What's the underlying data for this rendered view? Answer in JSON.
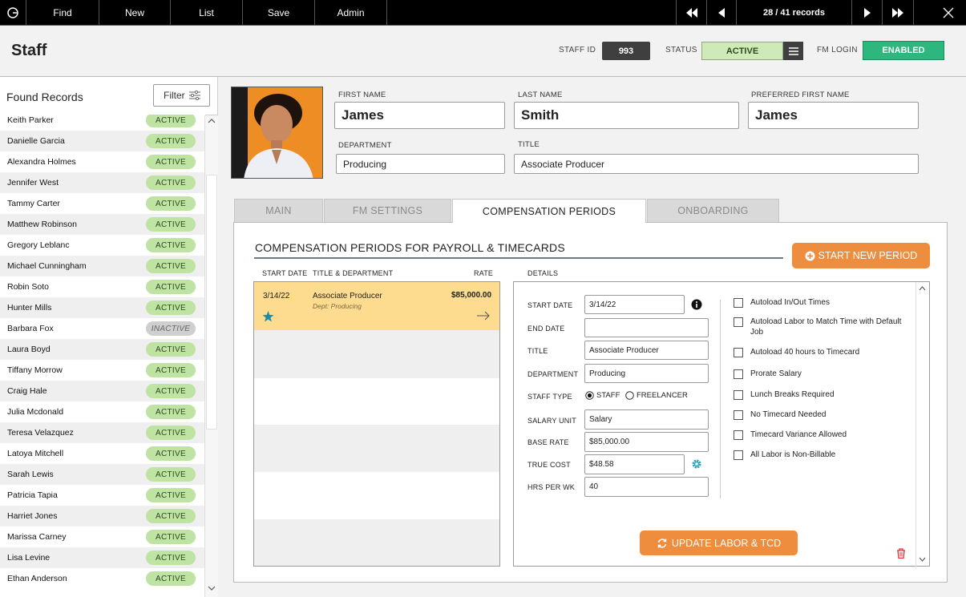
{
  "topbar": {
    "find": "Find",
    "new": "New",
    "list": "List",
    "save": "Save",
    "admin": "Admin",
    "record_counter": "28 / 41 records"
  },
  "header": {
    "title": "Staff",
    "staff_id_label": "STAFF ID",
    "staff_id": "993",
    "status_label": "STATUS",
    "status": "ACTIVE",
    "fm_login_label": "FM LOGIN",
    "fm_login": "ENABLED"
  },
  "sidebar": {
    "title": "Found Records",
    "filter_label": "Filter",
    "records": [
      {
        "name": "Keith Parker",
        "status": "ACTIVE"
      },
      {
        "name": "Danielle Garcia",
        "status": "ACTIVE"
      },
      {
        "name": "Alexandra Holmes",
        "status": "ACTIVE"
      },
      {
        "name": "Jennifer West",
        "status": "ACTIVE"
      },
      {
        "name": "Tammy Carter",
        "status": "ACTIVE"
      },
      {
        "name": "Matthew Robinson",
        "status": "ACTIVE"
      },
      {
        "name": "Gregory Leblanc",
        "status": "ACTIVE"
      },
      {
        "name": "Michael Cunningham",
        "status": "ACTIVE"
      },
      {
        "name": "Robin Soto",
        "status": "ACTIVE"
      },
      {
        "name": "Hunter Mills",
        "status": "ACTIVE"
      },
      {
        "name": "Barbara Fox",
        "status": "INACTIVE"
      },
      {
        "name": "Laura Boyd",
        "status": "ACTIVE"
      },
      {
        "name": "Tiffany Morrow",
        "status": "ACTIVE"
      },
      {
        "name": "Craig Hale",
        "status": "ACTIVE"
      },
      {
        "name": "Julia Mcdonald",
        "status": "ACTIVE"
      },
      {
        "name": "Teresa Velazquez",
        "status": "ACTIVE"
      },
      {
        "name": "Latoya Mitchell",
        "status": "ACTIVE"
      },
      {
        "name": "Sarah Lewis",
        "status": "ACTIVE"
      },
      {
        "name": "Patricia Tapia",
        "status": "ACTIVE"
      },
      {
        "name": "Harriet Jones",
        "status": "ACTIVE"
      },
      {
        "name": "Marissa Carney",
        "status": "ACTIVE"
      },
      {
        "name": "Lisa Levine",
        "status": "ACTIVE"
      },
      {
        "name": "Ethan Anderson",
        "status": "ACTIVE"
      }
    ]
  },
  "profile": {
    "first_name_label": "FIRST NAME",
    "first_name": "James",
    "last_name_label": "LAST NAME",
    "last_name": "Smith",
    "preferred_label": "PREFERRED FIRST NAME",
    "preferred": "James",
    "department_label": "DEPARTMENT",
    "department": "Producing",
    "title_label": "TITLE",
    "title": "Associate Producer"
  },
  "tabs": [
    "MAIN",
    "FM SETTINGS",
    "COMPENSATION PERIODS",
    "ONBOARDING"
  ],
  "comp": {
    "heading": "COMPENSATION PERIODS FOR PAYROLL & TIMECARDS",
    "start_new_label": "START NEW PERIOD",
    "col_start": "START DATE",
    "col_title": "TITLE & DEPARTMENT",
    "col_rate": "RATE",
    "col_details": "DETAILS",
    "period": {
      "start": "3/14/22",
      "title": "Associate Producer",
      "dept": "Dept: Producing",
      "rate": "$85,000.00"
    },
    "details": {
      "start_date_label": "START DATE",
      "start_date": "3/14/22",
      "end_date_label": "END DATE",
      "end_date": "",
      "title_label": "TITLE",
      "title": "Associate Producer",
      "department_label": "DEPARTMENT",
      "department": "Producing",
      "staff_type_label": "STAFF TYPE",
      "staff_opt": "STAFF",
      "freelancer_opt": "FREELANCER",
      "salary_unit_label": "SALARY UNIT",
      "salary_unit": "Salary",
      "base_rate_label": "BASE RATE",
      "base_rate": "$85,000.00",
      "true_cost_label": "TRUE COST",
      "true_cost": "$48.58",
      "hrs_label": "HRS PER WK",
      "hrs": "40"
    },
    "options": [
      "Autoload In/Out Times",
      "Autoload Labor to Match Time with Default Job",
      "Autoload 40 hours to Timecard",
      "Prorate Salary",
      "Lunch Breaks Required",
      "No Timecard Needed",
      "Timecard Variance Allowed",
      "All Labor is Non-Billable"
    ],
    "update_label": "UPDATE LABOR & TCD"
  },
  "colors": {
    "accent": "#ee8d3e",
    "active_green": "#bfe3a3",
    "enabled": "#2db67d",
    "highlight": "#fddc8f"
  }
}
